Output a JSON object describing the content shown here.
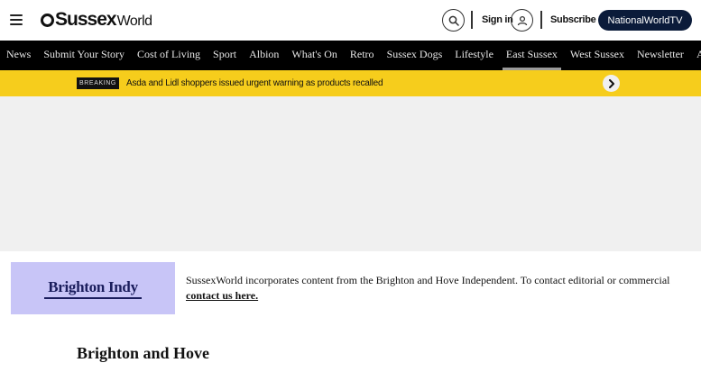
{
  "header": {
    "logo_bold": "Sussex",
    "logo_light": "World",
    "sign_in_label": "Sign in",
    "subscribe_label": "Subscribe",
    "tv_button_label": "NationalWorldTV",
    "tv_button_color": "#0b1b3a",
    "icons": [
      "menu-icon",
      "search-icon",
      "user-icon"
    ]
  },
  "nav": {
    "items": [
      {
        "label": "News"
      },
      {
        "label": "Submit Your Story"
      },
      {
        "label": "Cost of Living"
      },
      {
        "label": "Sport"
      },
      {
        "label": "Albion"
      },
      {
        "label": "What's On"
      },
      {
        "label": "Retro"
      },
      {
        "label": "Sussex Dogs"
      },
      {
        "label": "Lifestyle"
      },
      {
        "label": "East Sussex",
        "active": true
      },
      {
        "label": "West Sussex"
      },
      {
        "label": "Newsletter"
      },
      {
        "label": "Advertise"
      }
    ]
  },
  "breaking": {
    "badge": "BREAKING",
    "headline": "Asda and Lidl shoppers issued urgent warning as products recalled",
    "bar_color": "#f6cd1c"
  },
  "partner": {
    "logo_text": "Brighton Indy",
    "note_text": "SussexWorld incorporates content from the Brighton and Hove Independent. To contact editorial or commercial",
    "note_link": "contact us here."
  },
  "section": {
    "title": "Brighton and Hove"
  }
}
